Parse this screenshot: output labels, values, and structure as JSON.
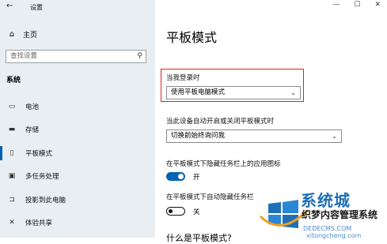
{
  "window": {
    "title": "设置",
    "controls": [
      "—",
      "☐",
      "✕"
    ]
  },
  "sidebar": {
    "home_label": "主页",
    "search_placeholder": "查找设置",
    "section_title": "系统",
    "items": [
      {
        "label": "电池"
      },
      {
        "label": "存储"
      },
      {
        "label": "平板模式"
      },
      {
        "label": "多任务处理"
      },
      {
        "label": "投影到此电脑"
      },
      {
        "label": "体验共享"
      }
    ]
  },
  "main": {
    "title": "平板模式",
    "login_label": "当我登录时",
    "login_select_value": "使用平板电脑模式",
    "switch_label": "当此设备自动开启或关闭平板模式时",
    "switch_select_value": "切换前始终询问我",
    "hide_icons_label": "在平板模式下隐藏任务栏上的应用图标",
    "hide_icons_state": "开",
    "autohide_label": "在平板模式下自动隐藏任务栏",
    "autohide_state": "关",
    "next_heading": "什么是平板模式?"
  },
  "watermark": {
    "line1": "系统城",
    "line2": "织梦内容管理系统",
    "line3": "DEDECMS.COM",
    "line4": "xitongcheng.com"
  },
  "colors": {
    "accent": "#0063b1",
    "highlight": "#e02020",
    "sidebar_bg": "#e9eef3"
  }
}
